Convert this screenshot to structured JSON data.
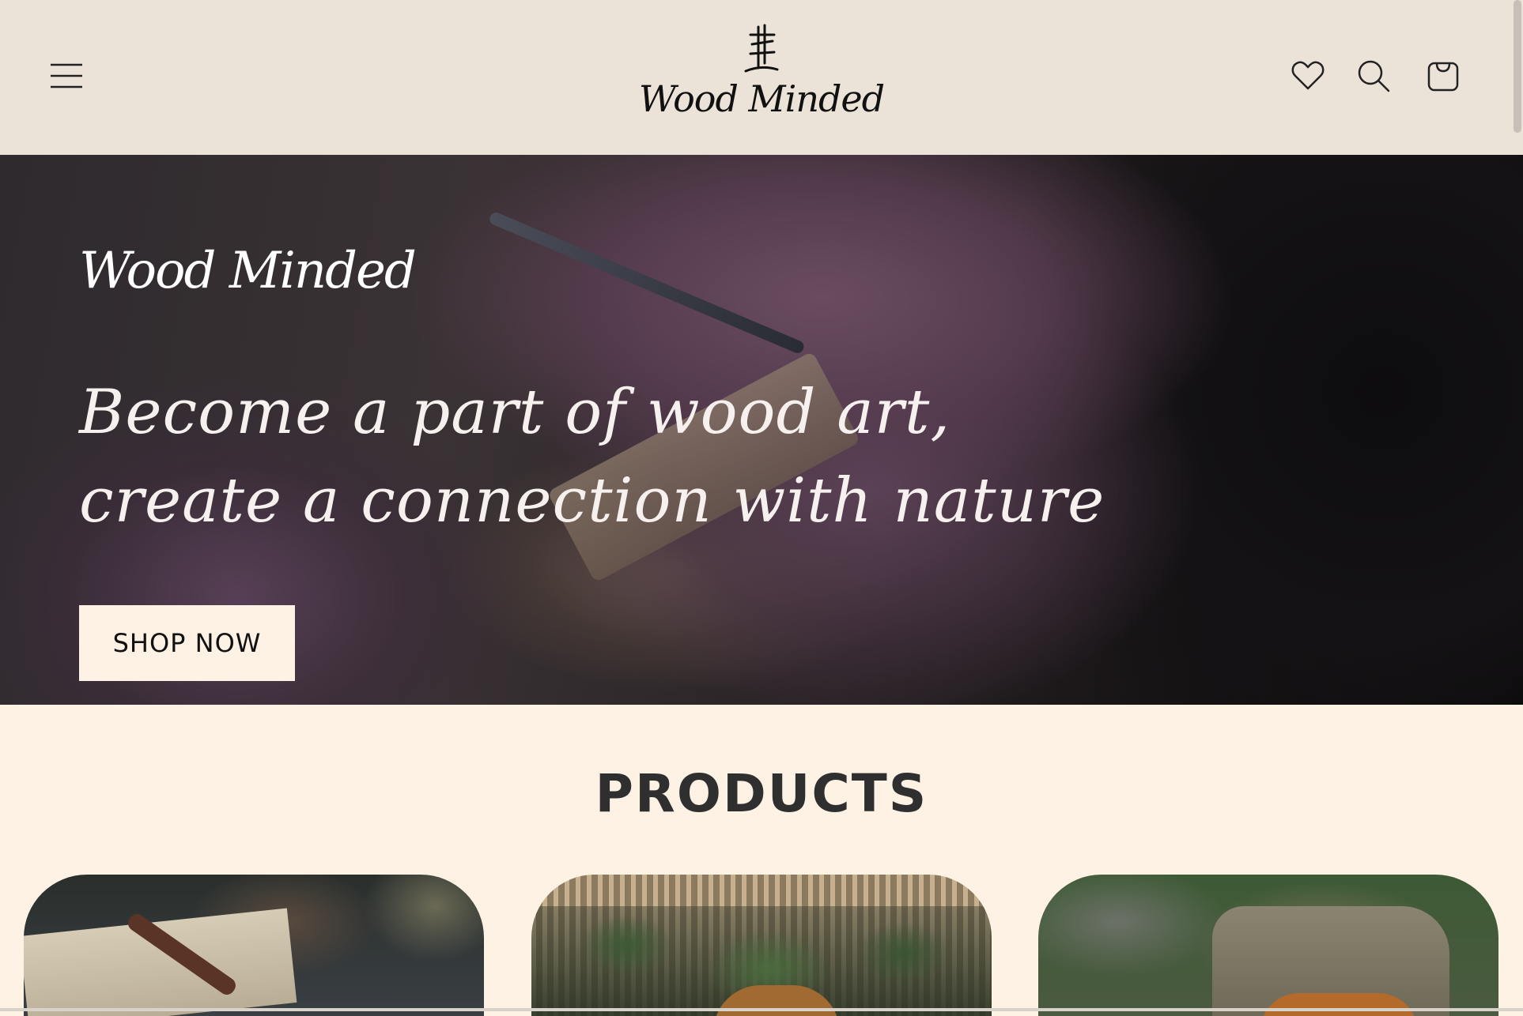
{
  "header": {
    "brand": "Wood Minded",
    "icons": {
      "menu": "menu-icon",
      "wishlist": "heart-icon",
      "search": "search-icon",
      "cart": "cart-icon"
    }
  },
  "hero": {
    "title": "Wood Minded",
    "heading": "Become a part of wood art, create a connection with nature",
    "cta_label": "SHOP NOW"
  },
  "products": {
    "title": "PRODUCTS",
    "cards": [
      "product-1",
      "product-2",
      "product-3"
    ]
  },
  "colors": {
    "header_bg": "#ebe3d8",
    "page_bg": "#fdf2e4",
    "button_bg": "#fdf2e4",
    "heading_text": "#2f2f2f"
  }
}
